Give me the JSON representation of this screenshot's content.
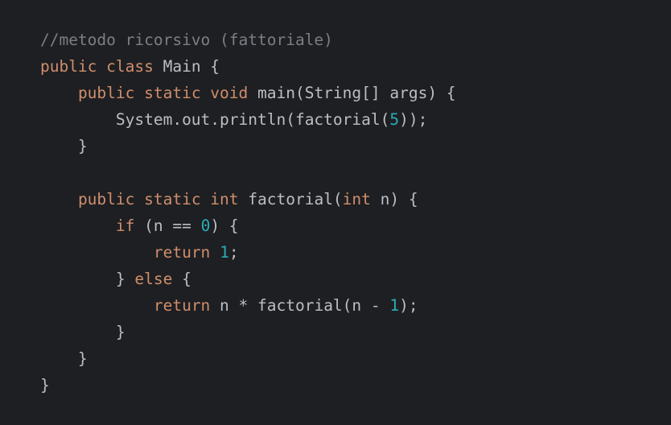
{
  "editor": {
    "lines": [
      [
        {
          "t": "//metodo ricorsivo (fattoriale)",
          "c": "comment"
        }
      ],
      [
        {
          "t": "public class",
          "c": "kw"
        },
        {
          "t": " Main {",
          "c": "plain"
        }
      ],
      [
        {
          "t": "    ",
          "c": "plain"
        },
        {
          "t": "public static void",
          "c": "kw"
        },
        {
          "t": " main(String[] args) {",
          "c": "plain"
        }
      ],
      [
        {
          "t": "        System.out.println(factorial(",
          "c": "plain"
        },
        {
          "t": "5",
          "c": "num"
        },
        {
          "t": "));",
          "c": "plain"
        }
      ],
      [
        {
          "t": "    }",
          "c": "plain"
        }
      ],
      [
        {
          "t": "",
          "c": "plain"
        }
      ],
      [
        {
          "t": "    ",
          "c": "plain"
        },
        {
          "t": "public static int",
          "c": "kw"
        },
        {
          "t": " factorial(",
          "c": "plain"
        },
        {
          "t": "int",
          "c": "kw"
        },
        {
          "t": " n) {",
          "c": "plain"
        }
      ],
      [
        {
          "t": "        ",
          "c": "plain"
        },
        {
          "t": "if",
          "c": "kw"
        },
        {
          "t": " (n == ",
          "c": "plain"
        },
        {
          "t": "0",
          "c": "num"
        },
        {
          "t": ") {",
          "c": "plain"
        }
      ],
      [
        {
          "t": "            ",
          "c": "plain"
        },
        {
          "t": "return",
          "c": "kw"
        },
        {
          "t": " ",
          "c": "plain"
        },
        {
          "t": "1",
          "c": "num"
        },
        {
          "t": ";",
          "c": "plain"
        }
      ],
      [
        {
          "t": "        } ",
          "c": "plain"
        },
        {
          "t": "else",
          "c": "kw"
        },
        {
          "t": " {",
          "c": "plain"
        }
      ],
      [
        {
          "t": "            ",
          "c": "plain"
        },
        {
          "t": "return",
          "c": "kw"
        },
        {
          "t": " n * factorial(n - ",
          "c": "plain"
        },
        {
          "t": "1",
          "c": "num"
        },
        {
          "t": ");",
          "c": "plain"
        }
      ],
      [
        {
          "t": "        }",
          "c": "plain"
        }
      ],
      [
        {
          "t": "    }",
          "c": "plain"
        }
      ],
      [
        {
          "t": "}",
          "c": "plain"
        }
      ]
    ]
  },
  "colors": {
    "background": "#1e1f22",
    "plain": "#bcbec4",
    "keyword": "#cf8e6d",
    "number": "#2aacb8",
    "comment": "#7a7e85"
  }
}
